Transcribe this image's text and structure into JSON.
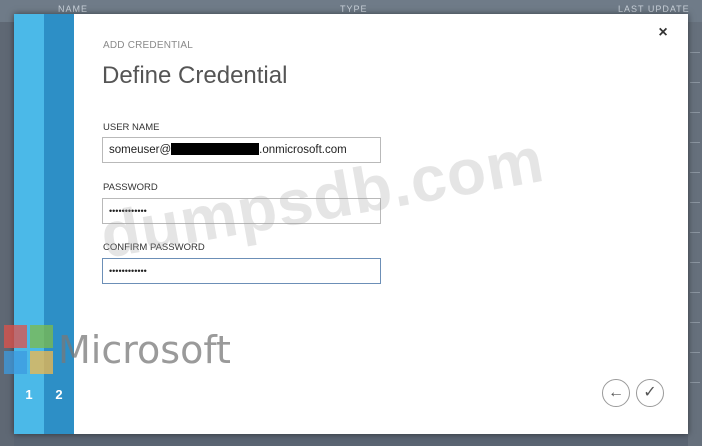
{
  "background": {
    "header_cols": [
      "NAME",
      "TYPE",
      "LAST UPDATE"
    ]
  },
  "dialog": {
    "crumb": "ADD CREDENTIAL",
    "title": "Define Credential",
    "close_icon": "×",
    "fields": {
      "user_name": {
        "label": "USER NAME",
        "value_prefix": "someuser@",
        "value_suffix": ".onmicrosoft.com"
      },
      "password": {
        "label": "PASSWORD",
        "value": "••••••••••••"
      },
      "confirm_password": {
        "label": "CONFIRM PASSWORD",
        "value": "••••••••••••"
      }
    },
    "steps": [
      "1",
      "2"
    ],
    "nav": {
      "back_icon": "←",
      "complete_icon": "✓"
    }
  },
  "watermark": {
    "text": "dumpsdb.com",
    "brand": "Microsoft"
  },
  "colors": {
    "step1": "#4bb9e8",
    "step2": "#2d8fc6",
    "field_focus": "#6c8fb7"
  }
}
